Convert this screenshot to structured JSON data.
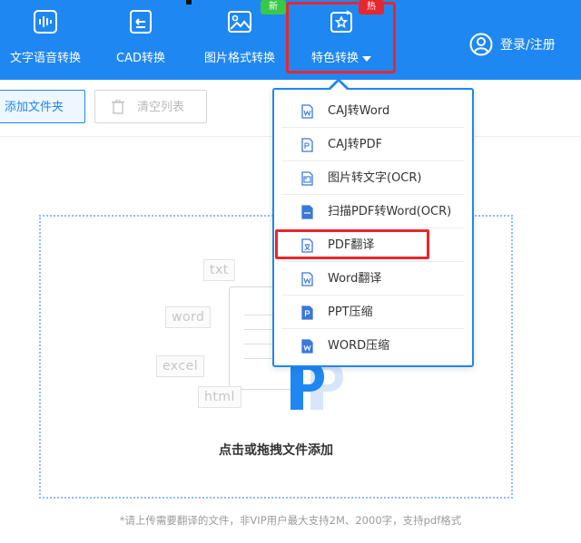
{
  "toolbar": {
    "items": [
      {
        "label": "文字语音转换",
        "icon": "waveform-icon"
      },
      {
        "label": "CAD转换",
        "icon": "cad-icon"
      },
      {
        "label": "图片格式转换",
        "icon": "image-icon"
      },
      {
        "label": "特色转换",
        "icon": "star-convert-icon"
      }
    ],
    "badge_new": "新",
    "badge_hot": "热",
    "login_label": "登录/注册",
    "colors": {
      "background": "#1f87f2",
      "text": "#ffffff",
      "highlight": "#e8262d",
      "badge_new": "#38c94a"
    }
  },
  "actions": {
    "add_folder": "添加文件夹",
    "clear_list": "清空列表"
  },
  "dropdown": {
    "items": [
      {
        "label": "CAJ转Word",
        "icon": "word-file-icon"
      },
      {
        "label": "CAJ转PDF",
        "icon": "pdf-file-icon"
      },
      {
        "label": "图片转文字(OCR)",
        "icon": "image-file-icon"
      },
      {
        "label": "扫描PDF转Word(OCR)",
        "icon": "scan-file-icon"
      },
      {
        "label": "PDF翻译",
        "icon": "translate-file-icon"
      },
      {
        "label": "Word翻译",
        "icon": "word-translate-icon"
      },
      {
        "label": "PPT压缩",
        "icon": "ppt-file-icon"
      },
      {
        "label": "WORD压缩",
        "icon": "word-compress-icon"
      }
    ],
    "highlighted": "PDF翻译"
  },
  "dropzone": {
    "ghost_labels": [
      "txt",
      "word",
      "excel",
      "html"
    ],
    "prompt": "点击或拖拽文件添加",
    "hint": "*请上传需要翻译的文件，非VIP用户最大支持2M、2000字，支持pdf格式"
  }
}
